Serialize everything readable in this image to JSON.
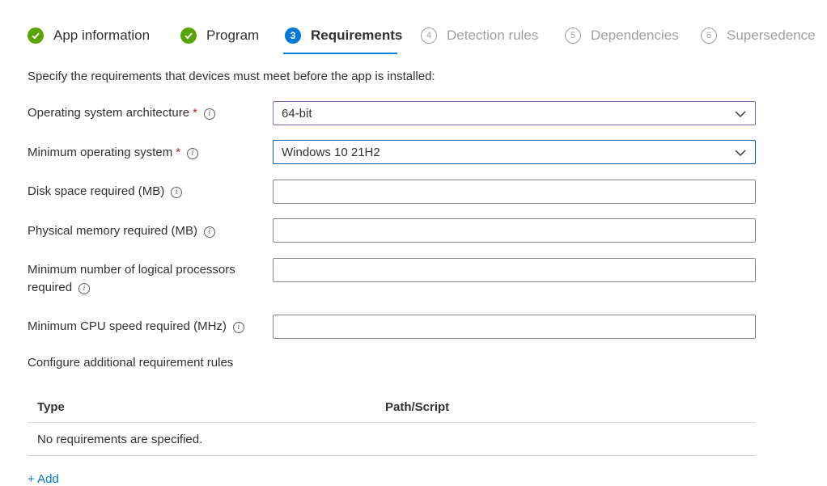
{
  "wizard": {
    "steps": [
      {
        "label": "App information",
        "state": "done",
        "number": ""
      },
      {
        "label": "Program",
        "state": "done",
        "number": ""
      },
      {
        "label": "Requirements",
        "state": "current",
        "number": "3"
      },
      {
        "label": "Detection rules",
        "state": "future",
        "number": "4"
      },
      {
        "label": "Dependencies",
        "state": "future",
        "number": "5"
      },
      {
        "label": "Supersedence",
        "state": "future",
        "number": "6"
      }
    ]
  },
  "description": "Specify the requirements that devices must meet before the app is installed:",
  "fields": {
    "os_architecture": {
      "label": "Operating system architecture",
      "required": "*",
      "value": "64-bit"
    },
    "min_os": {
      "label": "Minimum operating system",
      "required": "*",
      "value": "Windows 10 21H2"
    },
    "disk_space": {
      "label": "Disk space required (MB)",
      "value": ""
    },
    "physical_memory": {
      "label": "Physical memory required (MB)",
      "value": ""
    },
    "logical_processors": {
      "label": "Minimum number of logical processors required",
      "value": ""
    },
    "cpu_speed": {
      "label": "Minimum CPU speed required (MHz)",
      "value": ""
    }
  },
  "additional_rules": {
    "title": "Configure additional requirement rules",
    "columns": [
      "Type",
      "Path/Script"
    ],
    "empty_text": "No requirements are specified.",
    "add_label": "+ Add"
  },
  "colors": {
    "accent": "#0078d4",
    "done": "#57a300",
    "required": "#a4262c"
  }
}
